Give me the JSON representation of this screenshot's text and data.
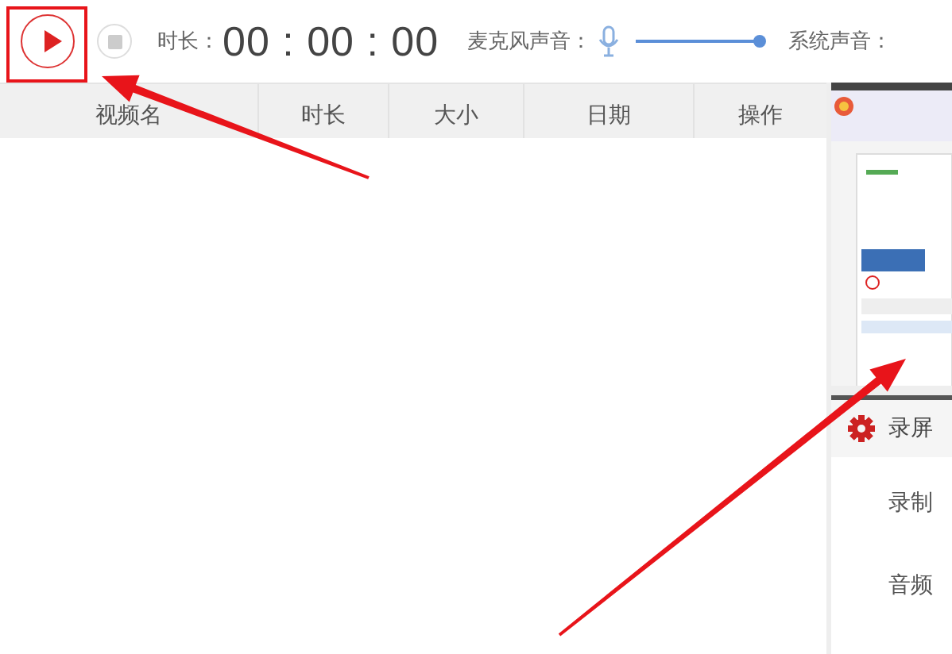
{
  "toolbar": {
    "duration_label": "时长：",
    "duration": "00 : 00 : 00",
    "mic_label": "麦克风声音：",
    "mic_volume": {
      "level": 1.0
    },
    "system_label": "系统声音："
  },
  "table": {
    "columns": [
      "视频名",
      "时长",
      "大小",
      "日期",
      "操作"
    ]
  },
  "settings": {
    "title": "录屏",
    "rows": [
      "录制",
      "音频"
    ]
  },
  "annotations": [
    {
      "kind": "box"
    },
    {
      "kind": "arrow"
    },
    {
      "kind": "arrow"
    }
  ]
}
